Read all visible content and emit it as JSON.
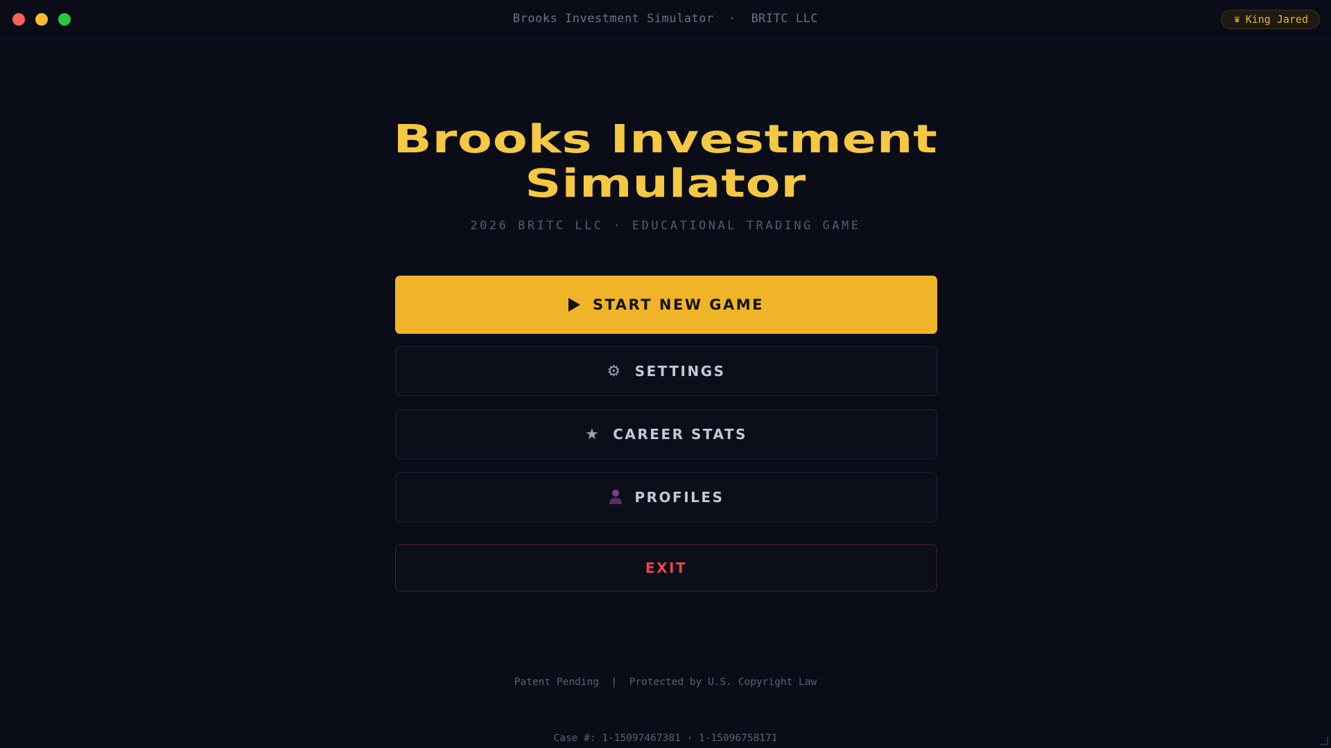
{
  "window": {
    "title": "Brooks Investment Simulator  ·  BRITC LLC",
    "user": "King Jared",
    "user_icon": "crown-icon"
  },
  "hero": {
    "title_line1": "Brooks Investment",
    "title_line2": "Simulator",
    "subtitle": "2026 BRITC LLC · EDUCATIONAL TRADING GAME"
  },
  "menu": {
    "start": {
      "label": "START NEW GAME",
      "icon": "play-icon"
    },
    "settings": {
      "label": "SETTINGS",
      "icon": "gear-icon"
    },
    "career": {
      "label": "CAREER STATS",
      "icon": "star-icon"
    },
    "profiles": {
      "label": "PROFILES",
      "icon": "person-icon"
    },
    "exit": {
      "label": "EXIT"
    }
  },
  "footer": {
    "line1": "Patent Pending  |  Protected by U.S. Copyright Law",
    "line2": "Case #: 1-15097467381 · 1-15096758171"
  },
  "colors": {
    "accent": "#f0b429",
    "title": "#f5c842",
    "danger": "#ef4444",
    "background": "#0a0c18"
  }
}
